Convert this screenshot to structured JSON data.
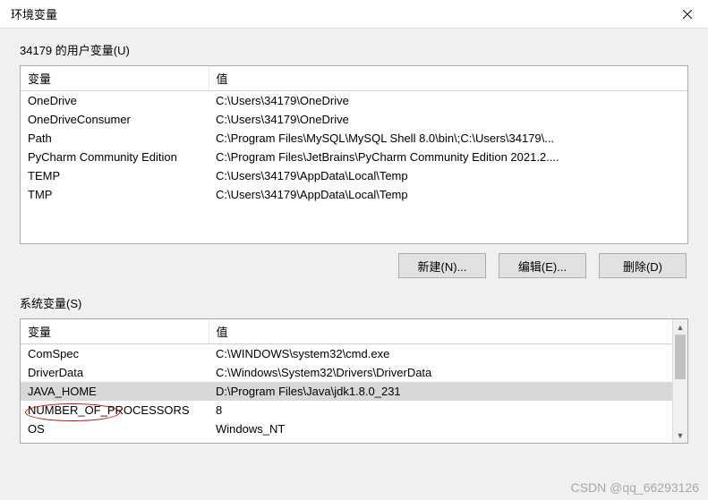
{
  "window": {
    "title": "环境变量"
  },
  "userVars": {
    "groupLabel": "34179 的用户变量(U)",
    "headers": {
      "var": "变量",
      "val": "值"
    },
    "rows": [
      {
        "var": "OneDrive",
        "val": "C:\\Users\\34179\\OneDrive"
      },
      {
        "var": "OneDriveConsumer",
        "val": "C:\\Users\\34179\\OneDrive"
      },
      {
        "var": "Path",
        "val": "C:\\Program Files\\MySQL\\MySQL Shell 8.0\\bin\\;C:\\Users\\34179\\..."
      },
      {
        "var": "PyCharm Community Edition",
        "val": "C:\\Program Files\\JetBrains\\PyCharm Community Edition 2021.2...."
      },
      {
        "var": "TEMP",
        "val": "C:\\Users\\34179\\AppData\\Local\\Temp"
      },
      {
        "var": "TMP",
        "val": "C:\\Users\\34179\\AppData\\Local\\Temp"
      }
    ],
    "buttons": {
      "new": "新建(N)...",
      "edit": "编辑(E)...",
      "delete": "删除(D)"
    }
  },
  "sysVars": {
    "groupLabel": "系统变量(S)",
    "headers": {
      "var": "变量",
      "val": "值"
    },
    "rows": [
      {
        "var": "ComSpec",
        "val": "C:\\WINDOWS\\system32\\cmd.exe"
      },
      {
        "var": "DriverData",
        "val": "C:\\Windows\\System32\\Drivers\\DriverData"
      },
      {
        "var": "JAVA_HOME",
        "val": "D:\\Program Files\\Java\\jdk1.8.0_231"
      },
      {
        "var": "NUMBER_OF_PROCESSORS",
        "val": "8"
      },
      {
        "var": "OS",
        "val": "Windows_NT"
      }
    ],
    "selectedIndex": 2
  },
  "watermark": "CSDN @qq_66293126"
}
